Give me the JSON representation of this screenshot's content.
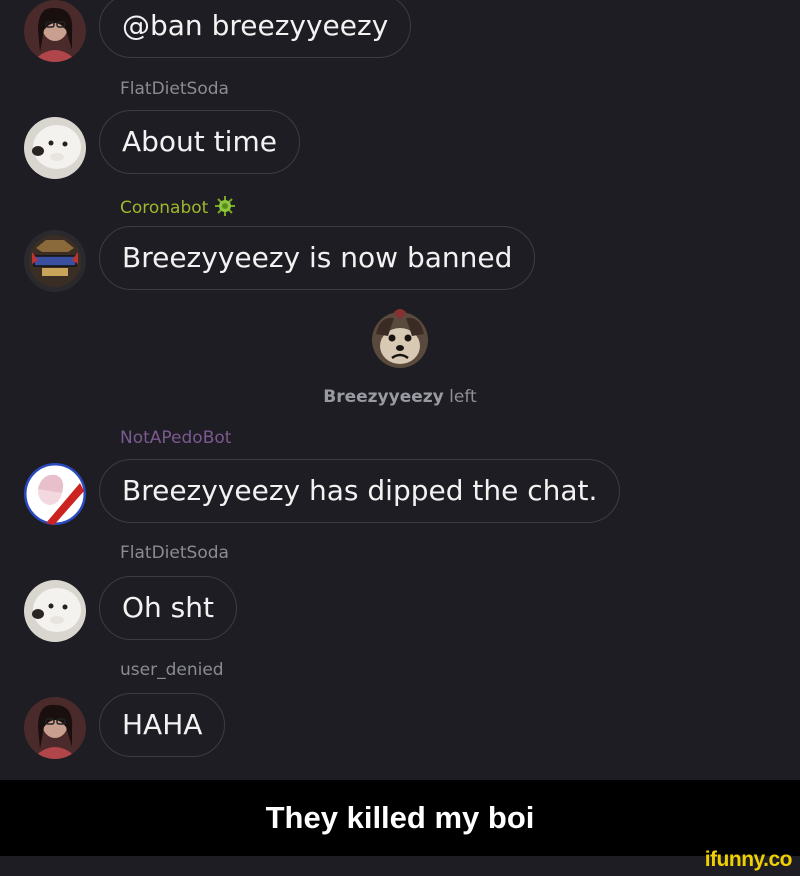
{
  "messages": [
    {
      "avatar": "woman-avatar",
      "text": "@ban breezyyeezy"
    },
    {
      "username": "FlatDietSoda",
      "avatar": "dog-avatar",
      "text": "About time"
    },
    {
      "username": "Coronabot",
      "username_color": "#a1b52c",
      "username_icon": "virus-icon",
      "avatar": "clever-bot-avatar",
      "text": "Breezyyeezy is now banned"
    },
    {
      "username": "NotAPedoBot",
      "username_color": "#7b5a8f",
      "avatar": "anime-badge-avatar",
      "text": "Breezyyeezy has dipped the chat."
    },
    {
      "username": "FlatDietSoda",
      "avatar": "dog-avatar",
      "text": "Oh sht"
    },
    {
      "username": "user_denied",
      "avatar": "woman-avatar",
      "text": "HAHA"
    }
  ],
  "system_event": {
    "icon": "sad-dog-icon",
    "user": "Breezyyeezy",
    "action": "left"
  },
  "caption": "They killed my boi",
  "watermark": "ifunny.co",
  "colors": {
    "background": "#1d1d23",
    "bubble_border": "#3c3c45",
    "coronabot_name": "#a1b52c",
    "notapedobot_name": "#7b5a8f",
    "watermark": "#f0d000"
  }
}
